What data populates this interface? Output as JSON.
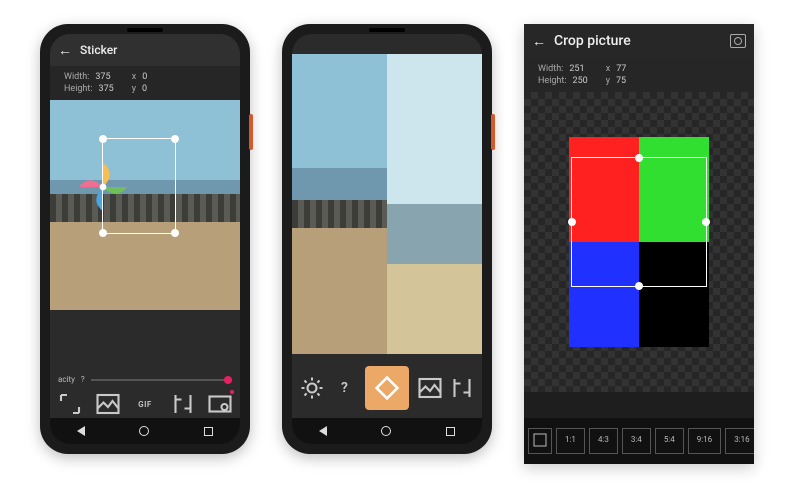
{
  "phone1": {
    "title": "Sticker",
    "dims": {
      "width_label": "Width:",
      "width": "375",
      "x_label": "x",
      "x": "0",
      "height_label": "Height:",
      "height": "375",
      "y_label": "y",
      "y": "0"
    },
    "slider_label": "acity",
    "tools": {
      "expand": "expand",
      "image": "image",
      "gif": "GIF",
      "compare": "compare",
      "effects": "effects"
    }
  },
  "phone2": {
    "tools": {
      "settings": "settings",
      "help": "?",
      "shape": "diamond",
      "image": "image",
      "compare": "compare"
    }
  },
  "panel3": {
    "title": "Crop picture",
    "dims": {
      "width_label": "Width:",
      "width": "251",
      "x_label": "x",
      "x": "77",
      "height_label": "Height:",
      "height": "250",
      "y_label": "y",
      "y": "75"
    },
    "ratios": [
      "1:1",
      "4:3",
      "3:4",
      "5:4",
      "9:16",
      "3:16"
    ]
  }
}
